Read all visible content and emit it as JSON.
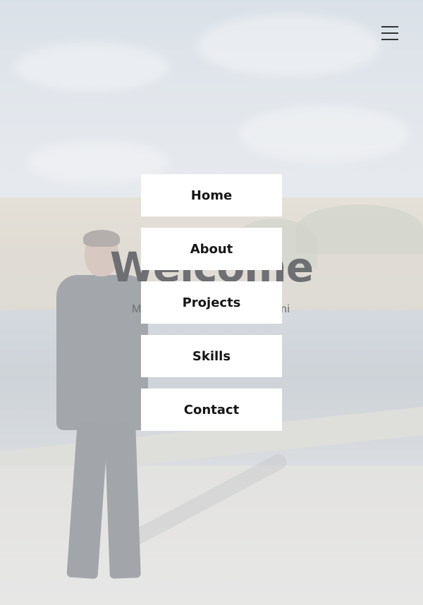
{
  "hero": {
    "title": "Welcome",
    "subtitle_left": "M",
    "subtitle_right": "ni"
  },
  "menu_toggle": {
    "icon": "hamburger-menu-icon"
  },
  "nav": {
    "items": [
      {
        "label": "Home"
      },
      {
        "label": "About"
      },
      {
        "label": "Projects"
      },
      {
        "label": "Skills"
      },
      {
        "label": "Contact"
      }
    ]
  },
  "colors": {
    "nav_background": "#ffffff",
    "nav_text": "#161616",
    "hero_text": "#6e6f73"
  }
}
